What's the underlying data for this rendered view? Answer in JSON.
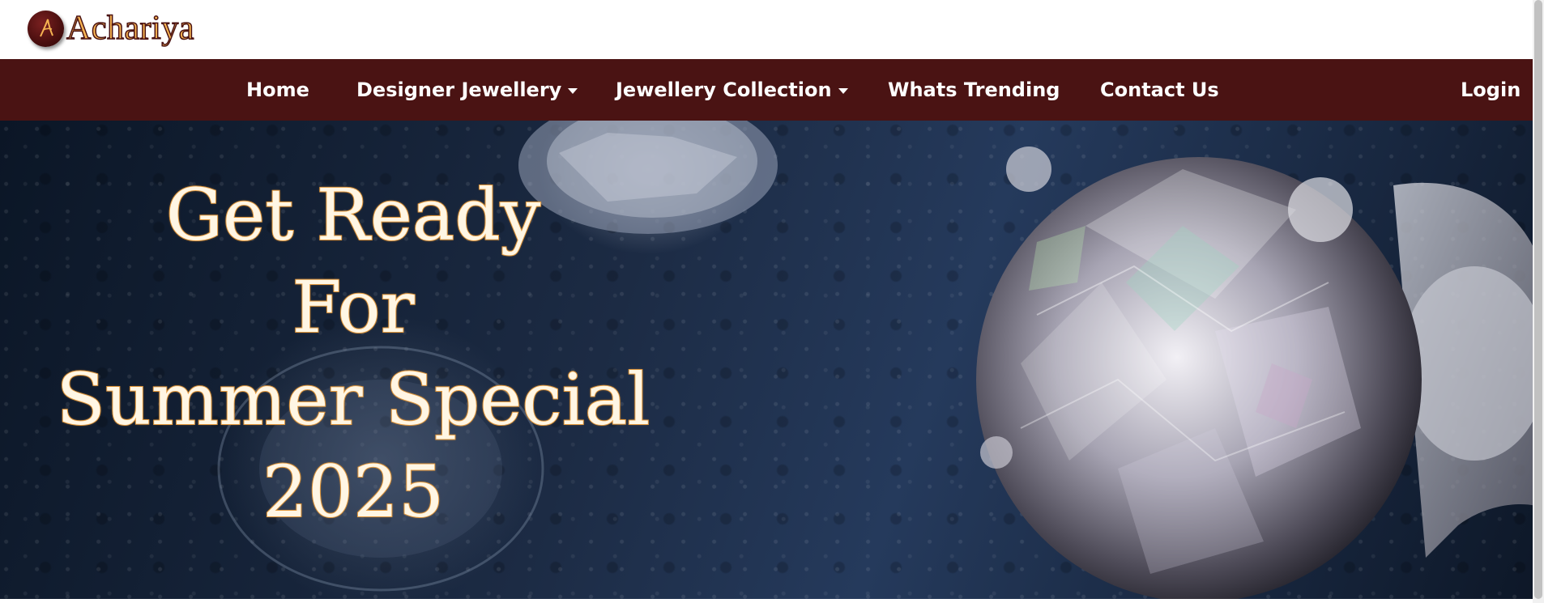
{
  "brand": {
    "name": "Achariya",
    "mark_letter": "A",
    "colors": {
      "maroon": "#4a1313",
      "gold": "#f7b452",
      "white": "#ffffff"
    }
  },
  "nav": {
    "items": [
      {
        "label": "Home",
        "has_dropdown": false
      },
      {
        "label": "Designer Jewellery",
        "has_dropdown": true
      },
      {
        "label": "Jewellery Collection",
        "has_dropdown": true
      },
      {
        "label": "Whats Trending",
        "has_dropdown": false
      },
      {
        "label": "Contact Us",
        "has_dropdown": false
      }
    ],
    "login": "Login"
  },
  "hero": {
    "lines": [
      "Get Ready",
      "For",
      "Summer Special",
      "2025"
    ],
    "image": "diamond-ring-banner"
  }
}
